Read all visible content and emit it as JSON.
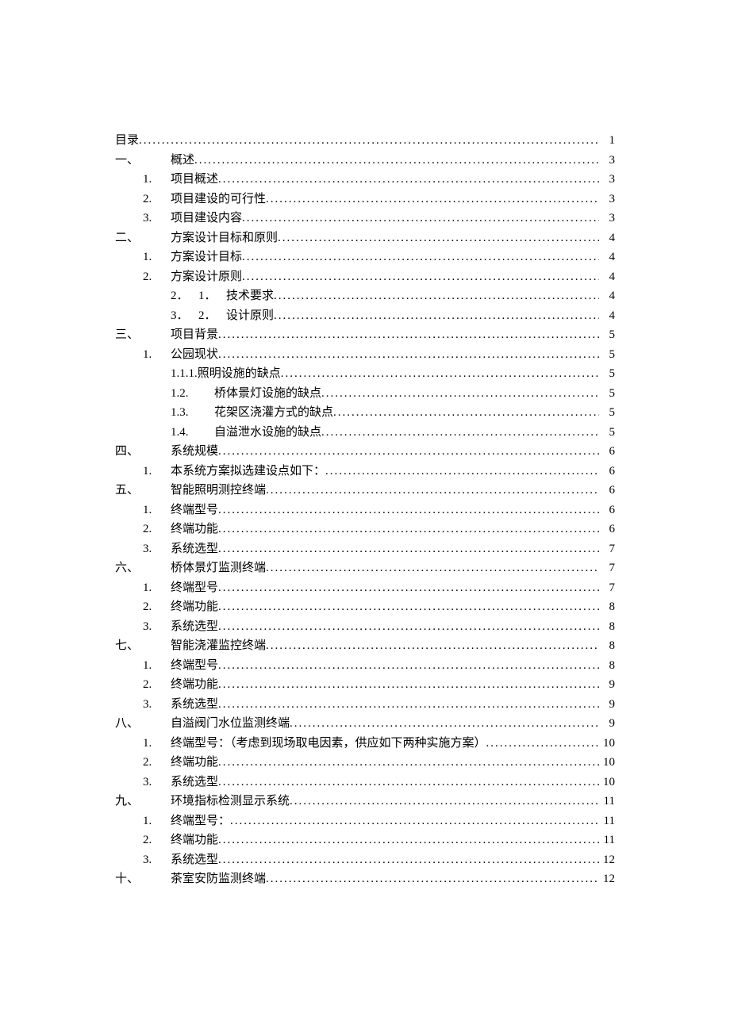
{
  "toc": [
    {
      "lvl": 0,
      "segments": [
        {
          "w": "",
          "t": "目录"
        }
      ],
      "page": "1"
    },
    {
      "lvl": 1,
      "segments": [
        {
          "w": "col-a",
          "t": "一、"
        },
        {
          "w": "",
          "t": "概述"
        }
      ],
      "page": "3"
    },
    {
      "lvl": 2,
      "segments": [
        {
          "w": "col-b",
          "t": "1."
        },
        {
          "w": "",
          "t": "项目概述"
        }
      ],
      "page": "3"
    },
    {
      "lvl": 2,
      "segments": [
        {
          "w": "col-b",
          "t": "2."
        },
        {
          "w": "",
          "t": "项目建设的可行性"
        }
      ],
      "page": "3"
    },
    {
      "lvl": 2,
      "segments": [
        {
          "w": "col-b",
          "t": "3."
        },
        {
          "w": "",
          "t": "项目建设内容"
        }
      ],
      "page": "3"
    },
    {
      "lvl": 1,
      "segments": [
        {
          "w": "col-a",
          "t": "二、"
        },
        {
          "w": "",
          "t": "方案设计目标和原则"
        }
      ],
      "page": "4"
    },
    {
      "lvl": 2,
      "segments": [
        {
          "w": "col-b",
          "t": "1."
        },
        {
          "w": "",
          "t": "方案设计目标"
        }
      ],
      "page": "4"
    },
    {
      "lvl": 2,
      "segments": [
        {
          "w": "col-b",
          "t": "2."
        },
        {
          "w": "",
          "t": "方案设计原则"
        }
      ],
      "page": "4"
    },
    {
      "lvl": 3,
      "segments": [
        {
          "w": "col-b",
          "t": "2．"
        },
        {
          "w": "col-b",
          "t": "1．"
        },
        {
          "w": "",
          "t": "技术要求"
        }
      ],
      "page": "4"
    },
    {
      "lvl": 3,
      "segments": [
        {
          "w": "col-b",
          "t": "3．"
        },
        {
          "w": "col-b",
          "t": "2．"
        },
        {
          "w": "",
          "t": "设计原则"
        }
      ],
      "page": "4"
    },
    {
      "lvl": 1,
      "segments": [
        {
          "w": "col-a",
          "t": "三、"
        },
        {
          "w": "",
          "t": "项目背景"
        }
      ],
      "page": "5"
    },
    {
      "lvl": 2,
      "segments": [
        {
          "w": "col-b",
          "t": "1."
        },
        {
          "w": "",
          "t": "公园现状"
        }
      ],
      "page": "5"
    },
    {
      "lvl": 3,
      "segments": [
        {
          "w": "",
          "t": "1.1.1.照明设施的缺点"
        }
      ],
      "page": "5"
    },
    {
      "lvl": 3,
      "segments": [
        {
          "w": "sub-num",
          "t": "1.2."
        },
        {
          "w": "",
          "t": "桥体景灯设施的缺点"
        }
      ],
      "page": "5"
    },
    {
      "lvl": 3,
      "segments": [
        {
          "w": "sub-num",
          "t": "1.3."
        },
        {
          "w": "",
          "t": "花架区浇灌方式的缺点"
        }
      ],
      "page": "5"
    },
    {
      "lvl": 3,
      "segments": [
        {
          "w": "sub-num",
          "t": "1.4."
        },
        {
          "w": "",
          "t": "自溢泄水设施的缺点"
        }
      ],
      "page": "5"
    },
    {
      "lvl": 1,
      "segments": [
        {
          "w": "col-a",
          "t": "四、"
        },
        {
          "w": "",
          "t": "系统规模"
        }
      ],
      "page": "6"
    },
    {
      "lvl": 2,
      "segments": [
        {
          "w": "col-b",
          "t": "1."
        },
        {
          "w": "",
          "t": "本系统方案拟选建设点如下："
        }
      ],
      "page": "6"
    },
    {
      "lvl": 1,
      "segments": [
        {
          "w": "col-a",
          "t": "五、"
        },
        {
          "w": "",
          "t": "智能照明测控终端"
        }
      ],
      "page": "6"
    },
    {
      "lvl": 2,
      "segments": [
        {
          "w": "col-b",
          "t": "1."
        },
        {
          "w": "",
          "t": "终端型号"
        }
      ],
      "page": "6"
    },
    {
      "lvl": 2,
      "segments": [
        {
          "w": "col-b",
          "t": "2."
        },
        {
          "w": "",
          "t": "终端功能"
        }
      ],
      "page": "6"
    },
    {
      "lvl": 2,
      "segments": [
        {
          "w": "col-b",
          "t": "3."
        },
        {
          "w": "",
          "t": "系统选型"
        }
      ],
      "page": "7"
    },
    {
      "lvl": 1,
      "segments": [
        {
          "w": "col-a",
          "t": "六、"
        },
        {
          "w": "",
          "t": "桥体景灯监测终端"
        }
      ],
      "page": "7"
    },
    {
      "lvl": 2,
      "segments": [
        {
          "w": "col-b",
          "t": "1."
        },
        {
          "w": "",
          "t": "终端型号"
        }
      ],
      "page": "7"
    },
    {
      "lvl": 2,
      "segments": [
        {
          "w": "col-b",
          "t": "2."
        },
        {
          "w": "",
          "t": "终端功能"
        }
      ],
      "page": "8"
    },
    {
      "lvl": 2,
      "segments": [
        {
          "w": "col-b",
          "t": "3."
        },
        {
          "w": "",
          "t": "系统选型"
        }
      ],
      "page": "8"
    },
    {
      "lvl": 1,
      "segments": [
        {
          "w": "col-a",
          "t": "七、"
        },
        {
          "w": "",
          "t": "智能浇灌监控终端"
        }
      ],
      "page": "8"
    },
    {
      "lvl": 2,
      "segments": [
        {
          "w": "col-b",
          "t": "1."
        },
        {
          "w": "",
          "t": "终端型号"
        }
      ],
      "page": "8"
    },
    {
      "lvl": 2,
      "segments": [
        {
          "w": "col-b",
          "t": "2."
        },
        {
          "w": "",
          "t": "终端功能"
        }
      ],
      "page": "9"
    },
    {
      "lvl": 2,
      "segments": [
        {
          "w": "col-b",
          "t": "3."
        },
        {
          "w": "",
          "t": "系统选型"
        }
      ],
      "page": "9"
    },
    {
      "lvl": 1,
      "segments": [
        {
          "w": "col-a",
          "t": "八、"
        },
        {
          "w": "",
          "t": "自溢阀门水位监测终端"
        }
      ],
      "page": "9"
    },
    {
      "lvl": 2,
      "segments": [
        {
          "w": "col-b",
          "t": "1."
        },
        {
          "w": "",
          "t": "终端型号：（考虑到现场取电因素，供应如下两种实施方案）"
        }
      ],
      "page": "10"
    },
    {
      "lvl": 2,
      "segments": [
        {
          "w": "col-b",
          "t": "2."
        },
        {
          "w": "",
          "t": "终端功能"
        }
      ],
      "page": "10"
    },
    {
      "lvl": 2,
      "segments": [
        {
          "w": "col-b",
          "t": "3."
        },
        {
          "w": "",
          "t": "系统选型"
        }
      ],
      "page": "10"
    },
    {
      "lvl": 1,
      "segments": [
        {
          "w": "col-a",
          "t": "九、"
        },
        {
          "w": "",
          "t": "环境指标检测显示系统"
        }
      ],
      "page": "11"
    },
    {
      "lvl": 2,
      "segments": [
        {
          "w": "col-b",
          "t": "1."
        },
        {
          "w": "",
          "t": "终端型号："
        }
      ],
      "page": "11"
    },
    {
      "lvl": 2,
      "segments": [
        {
          "w": "col-b",
          "t": "2."
        },
        {
          "w": "",
          "t": "终端功能"
        }
      ],
      "page": "11"
    },
    {
      "lvl": 2,
      "segments": [
        {
          "w": "col-b",
          "t": "3."
        },
        {
          "w": "",
          "t": "系统选型"
        }
      ],
      "page": "12"
    },
    {
      "lvl": 1,
      "segments": [
        {
          "w": "col-a",
          "t": "十、"
        },
        {
          "w": "",
          "t": "茶室安防监测终端"
        }
      ],
      "page": "12"
    }
  ]
}
